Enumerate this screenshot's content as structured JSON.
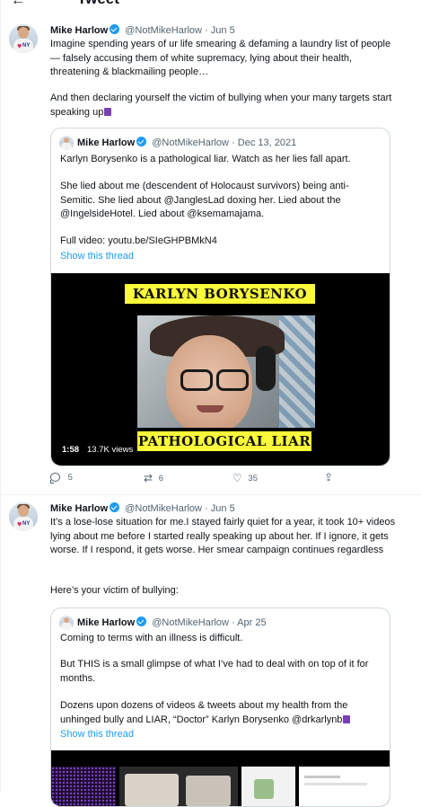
{
  "header": {
    "title": "Tweet",
    "back_icon": "arrow-left-icon"
  },
  "tweets": [
    {
      "name": "Mike Harlow",
      "handle": "@NotMikeHarlow",
      "date": "· Jun 5",
      "verified": true,
      "text": "Imagine spending years of ur life smearing & defaming a laundry list of people — falsely accusing them of white supremacy, lying about their health, threatening & blackmailing people…",
      "text2": "And then declaring yourself the victim of bullying when your many targets start speaking up",
      "emoji": "thread-spool-emoji",
      "quote": {
        "name": "Mike Harlow",
        "handle": "@NotMikeHarlow",
        "date": "· Dec 13, 2021",
        "line1": "Karlyn Borysenko is a pathological liar. Watch as her lies fall apart.",
        "line2": "She lied about me (descendent of Holocaust survivors) being anti-Semitic. She lied about @JanglesLad doxing her. Lied about the @IngelsideHotel. Lied about @ksemamajama.",
        "line3": "Full video: youtu.be/SIeGHPBMkN4",
        "show_thread": "Show this thread",
        "video": {
          "banner_top": "KARLYN BORYSENKO",
          "banner_bottom": "PATHOLOGICAL LIAR",
          "duration": "1:58",
          "views": "13.7K views"
        }
      },
      "actions": {
        "replies": "5",
        "retweets": "6",
        "likes": "35"
      }
    },
    {
      "name": "Mike Harlow",
      "handle": "@NotMikeHarlow",
      "date": "· Jun 5",
      "verified": true,
      "text": "It’s a lose-lose situation for me.I stayed fairly quiet for a year, it took 10+ videos lying about me before I started really speaking up about her. If I ignore, it gets worse. If I respond, it gets worse. Her smear campaign continues regardless",
      "text2": "Here’s your victim of bullying:",
      "quote": {
        "name": "Mike Harlow",
        "handle": "@NotMikeHarlow",
        "date": "· Apr 25",
        "line1": "Coming to terms with an illness is difficult.",
        "line2": "But THIS is a small glimpse of what I’ve had to deal with on top of it for months.",
        "line3": "Dozens upon dozens of videos & tweets about my health from the unhinged bully and LIAR, “Doctor” Karlyn Borysenko @drkarlynb",
        "show_thread": "Show this thread"
      }
    }
  ],
  "colors": {
    "accent": "#1d9bf0",
    "secondary_text": "#536471",
    "banner_yellow": "#fafa3a"
  }
}
